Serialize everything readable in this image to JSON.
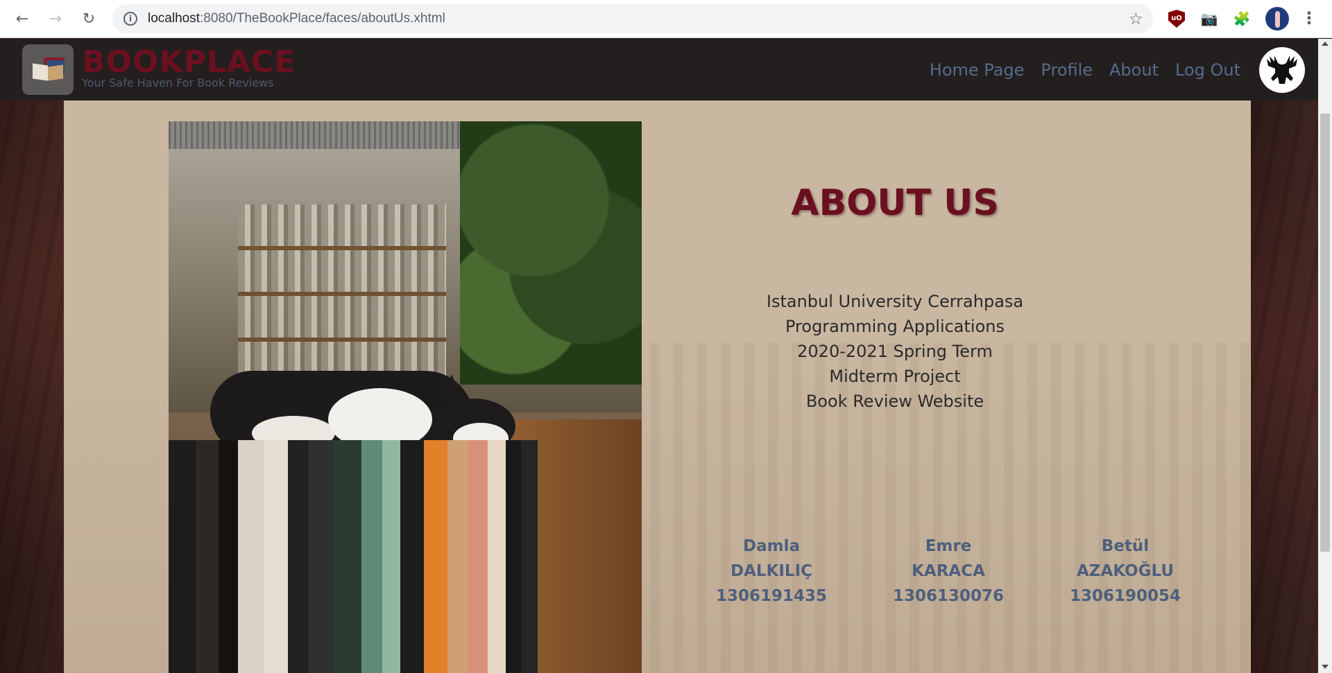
{
  "browser": {
    "url_host": "localhost",
    "url_path": ":8080/TheBookPlace/faces/aboutUs.xhtml",
    "ublock_label": "uO"
  },
  "site": {
    "brand": "BOOKPLACE",
    "tagline": "Your Safe Haven For Book Reviews",
    "nav": [
      "Home Page",
      "Profile",
      "About",
      "Log Out"
    ]
  },
  "about": {
    "title": "ABOUT US",
    "lines": [
      "Istanbul University Cerrahpasa",
      "Programming Applications",
      "2020-2021 Spring Term",
      "Midterm Project",
      "Book Review Website"
    ],
    "team": [
      {
        "first": "Damla",
        "last": "DALKILIÇ",
        "id": "1306191435"
      },
      {
        "first": "Emre",
        "last": "KARACA",
        "id": "1306130076"
      },
      {
        "first": "Betül",
        "last": "AZAKOĞLU",
        "id": "1306190054"
      }
    ]
  },
  "colors": {
    "brand": "#6b1020",
    "nav_link": "#566b8e",
    "panel": "#c9b7a1",
    "header": "#231f1e"
  }
}
